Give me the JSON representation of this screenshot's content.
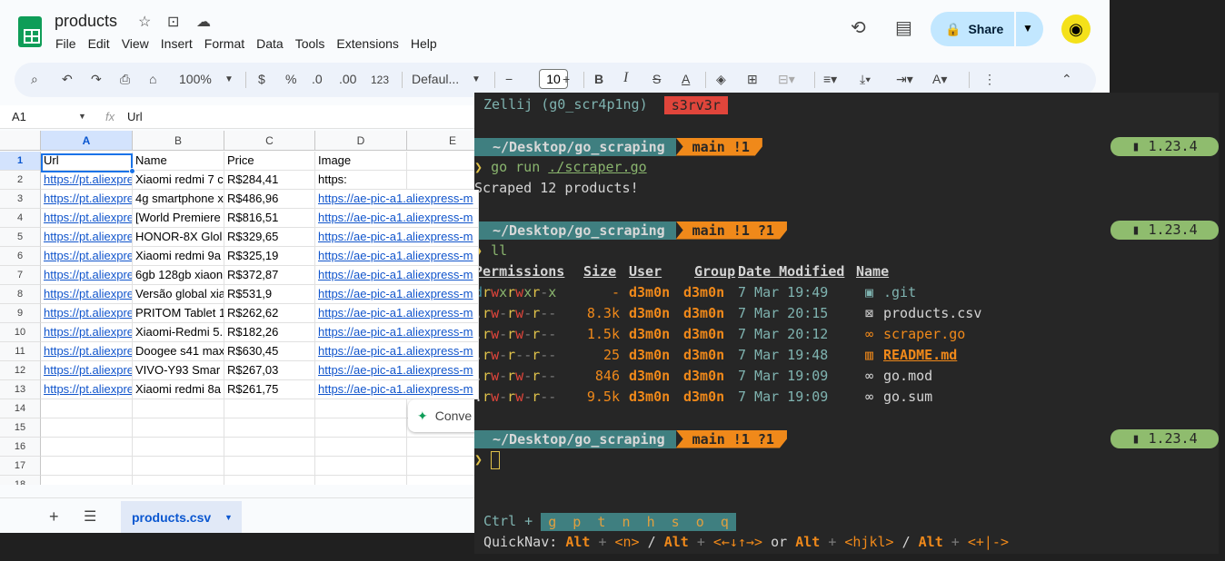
{
  "app": {
    "title": "products",
    "menu": [
      "File",
      "Edit",
      "View",
      "Insert",
      "Format",
      "Data",
      "Tools",
      "Extensions",
      "Help"
    ],
    "share_label": "Share"
  },
  "toolbar": {
    "zoom": "100%",
    "currency": "$",
    "percent": "%",
    "dec_less": ".0",
    "dec_more": ".00",
    "num_format": "123",
    "font": "Defaul...",
    "font_size": "10"
  },
  "formula_bar": {
    "cell_ref": "A1",
    "fx": "fx",
    "value": "Url"
  },
  "sheet": {
    "columns": [
      "A",
      "B",
      "C",
      "D",
      "E"
    ],
    "rows": [
      "1",
      "2",
      "3",
      "4",
      "5",
      "6",
      "7",
      "8",
      "9",
      "10",
      "11",
      "12",
      "13",
      "14",
      "15",
      "16",
      "17",
      "18"
    ],
    "data": [
      [
        "Url",
        "Name",
        "Price",
        "Image"
      ],
      [
        "https://pt.aliexpre",
        "Xiaomi redmi 7 c",
        "R$284,41",
        "https:"
      ],
      [
        "https://pt.aliexpre",
        "4g smartphone x",
        "R$486,96",
        "https://ae-pic-a1.aliexpress-m"
      ],
      [
        "https://pt.aliexpre",
        "[World Premiere",
        "R$816,51",
        "https://ae-pic-a1.aliexpress-m"
      ],
      [
        "https://pt.aliexpre",
        "HONOR-8X Glol",
        "R$329,65",
        "https://ae-pic-a1.aliexpress-m"
      ],
      [
        "https://pt.aliexpre",
        "Xiaomi redmi 9a",
        "R$325,19",
        "https://ae-pic-a1.aliexpress-m"
      ],
      [
        "https://pt.aliexpre",
        "6gb 128gb xiaon",
        "R$372,87",
        "https://ae-pic-a1.aliexpress-m"
      ],
      [
        "https://pt.aliexpre",
        "Versão global xia",
        "R$531,9",
        "https://ae-pic-a1.aliexpress-m"
      ],
      [
        "https://pt.aliexpre",
        "PRITOM Tablet 1",
        "R$262,62",
        "https://ae-pic-a1.aliexpress-m"
      ],
      [
        "https://pt.aliexpre",
        "Xiaomi-Redmi 5.",
        "R$182,26",
        "https://ae-pic-a1.aliexpress-m"
      ],
      [
        "https://pt.aliexpre",
        "Doogee s41 max",
        "R$630,45",
        "https://ae-pic-a1.aliexpress-m"
      ],
      [
        "https://pt.aliexpre",
        "VIVO-Y93 Smar",
        "R$267,03",
        "https://ae-pic-a1.aliexpress-m"
      ],
      [
        "https://pt.aliexpre",
        "Xiaomi redmi 8a",
        "R$261,75",
        "https://ae-pic-a1.aliexpress-m"
      ]
    ],
    "convert_label": "Conve",
    "tab_name": "products.csv"
  },
  "terminal": {
    "session": "Zellij (g0_scr4p1ng)",
    "session_badge": "s3rv3r",
    "path": "~/Desktop/go_scraping",
    "branch1": "main !1",
    "branch2": "main !1 ?1",
    "go_version": "1.23.4",
    "cmd1_prompt": "❯",
    "cmd1": "go run",
    "cmd1_arg": "./scraper.go",
    "output1": "Scraped 12 products!",
    "cmd2": "ll",
    "headers": [
      "Permissions",
      "Size",
      "User",
      "Group",
      "Date Modified",
      "Name"
    ],
    "files": [
      {
        "perm": "drwxrwxr-x",
        "size": "-",
        "user": "d3m0n",
        "group": "d3m0n",
        "date": "7 Mar 19:49",
        "icon": "▣",
        "name": ".git"
      },
      {
        "perm": ".rw-rw-r--",
        "size": "8.3k",
        "user": "d3m0n",
        "group": "d3m0n",
        "date": "7 Mar 20:15",
        "icon": "⊠",
        "name": "products.csv"
      },
      {
        "perm": ".rw-rw-r--",
        "size": "1.5k",
        "user": "d3m0n",
        "group": "d3m0n",
        "date": "7 Mar 20:12",
        "icon": "∞",
        "name": "scraper.go"
      },
      {
        "perm": ".rw-r--r--",
        "size": "25",
        "user": "d3m0n",
        "group": "d3m0n",
        "date": "7 Mar 19:48",
        "icon": "▥",
        "name": "README.md"
      },
      {
        "perm": ".rw-rw-r--",
        "size": "846",
        "user": "d3m0n",
        "group": "d3m0n",
        "date": "7 Mar 19:09",
        "icon": "∞",
        "name": "go.mod"
      },
      {
        "perm": ".rw-rw-r--",
        "size": "9.5k",
        "user": "d3m0n",
        "group": "d3m0n",
        "date": "7 Mar 19:09",
        "icon": "∞",
        "name": "go.sum"
      }
    ],
    "ctrl_label": "Ctrl +",
    "ctrl_keys": "g  p  t  n  h  s  o  q",
    "quicknav": "QuickNav:",
    "qn_alt": "Alt",
    "qn_n": "<n>",
    "qn_arrows": "<←↓↑→>",
    "qn_or": "or",
    "qn_hjkl": "<hjkl>",
    "qn_pm": "<+|->"
  }
}
